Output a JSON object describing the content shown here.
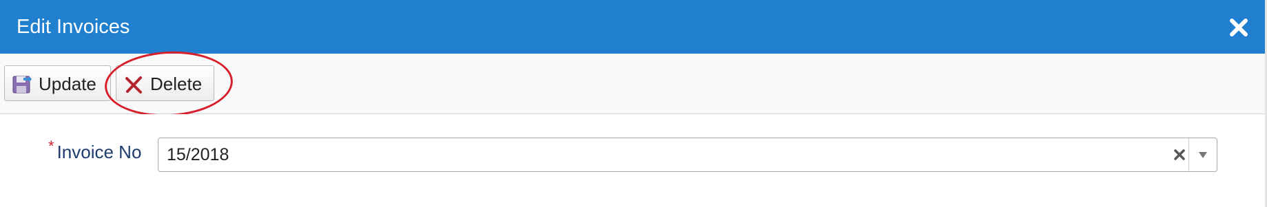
{
  "dialog": {
    "title": "Edit Invoices",
    "close_icon": "close-icon",
    "accent_color": "#2080cf"
  },
  "toolbar": {
    "update_label": "Update",
    "update_icon": "save-icon",
    "delete_label": "Delete",
    "delete_icon": "delete-x-icon"
  },
  "form": {
    "invoice_no": {
      "required_marker": "*",
      "label": "Invoice No",
      "value": "15/2018",
      "clear_icon": "clear-icon",
      "dropdown_icon": "dropdown-arrow-icon"
    }
  },
  "annotation": {
    "type": "red-circle-highlight",
    "target": "delete-button",
    "color": "#d71f2b"
  }
}
